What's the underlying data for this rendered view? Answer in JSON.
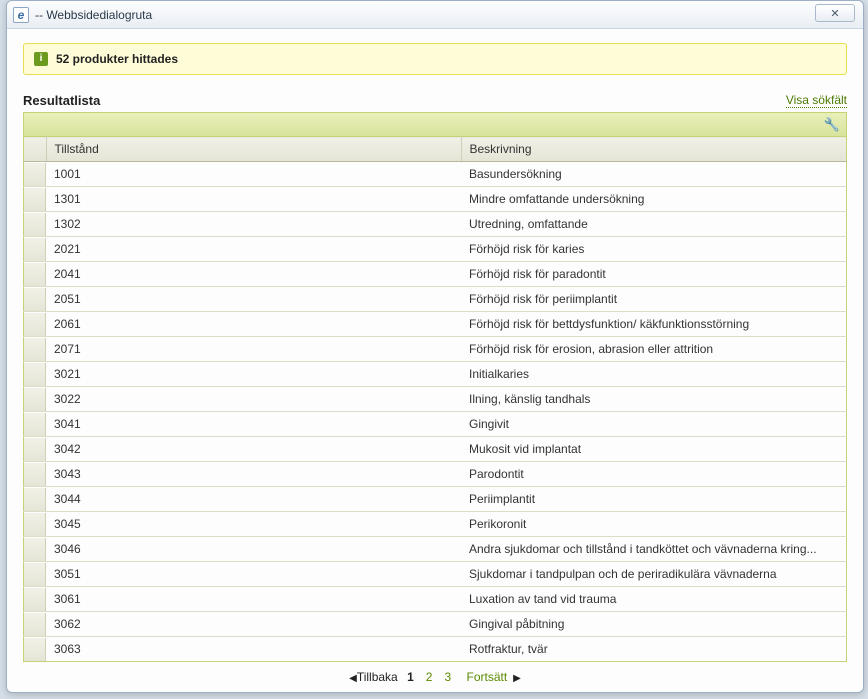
{
  "window": {
    "title": " -- Webbsidedialogruta",
    "close_label": "✕"
  },
  "banner": {
    "message": "52 produkter hittades"
  },
  "list": {
    "title": "Resultatlista",
    "show_search_label": "Visa sökfält"
  },
  "columns": {
    "code": "Tillstånd",
    "desc": "Beskrivning"
  },
  "rows": [
    {
      "code": "1001",
      "desc": "Basundersökning"
    },
    {
      "code": "1301",
      "desc": "Mindre omfattande undersökning"
    },
    {
      "code": "1302",
      "desc": "Utredning, omfattande"
    },
    {
      "code": "2021",
      "desc": "Förhöjd risk för karies"
    },
    {
      "code": "2041",
      "desc": "Förhöjd risk för paradontit"
    },
    {
      "code": "2051",
      "desc": "Förhöjd risk för periimplantit"
    },
    {
      "code": "2061",
      "desc": "Förhöjd risk för bettdysfunktion/ käkfunktionsstörning"
    },
    {
      "code": "2071",
      "desc": "Förhöjd risk för erosion, abrasion eller attrition"
    },
    {
      "code": "3021",
      "desc": "Initialkaries"
    },
    {
      "code": "3022",
      "desc": "Ilning, känslig tandhals"
    },
    {
      "code": "3041",
      "desc": "Gingivit"
    },
    {
      "code": "3042",
      "desc": "Mukosit vid implantat"
    },
    {
      "code": "3043",
      "desc": "Parodontit"
    },
    {
      "code": "3044",
      "desc": "Periimplantit"
    },
    {
      "code": "3045",
      "desc": "Perikoronit"
    },
    {
      "code": "3046",
      "desc": "Andra sjukdomar och tillstånd i tandköttet och vävnaderna kring..."
    },
    {
      "code": "3051",
      "desc": "Sjukdomar i tandpulpan och de periradikulära vävnaderna"
    },
    {
      "code": "3061",
      "desc": "Luxation av tand vid trauma"
    },
    {
      "code": "3062",
      "desc": "Gingival påbitning"
    },
    {
      "code": "3063",
      "desc": "Rotfraktur, tvär"
    }
  ],
  "pager": {
    "back_label": "Tillbaka",
    "forward_label": "Fortsätt",
    "pages": [
      "1",
      "2",
      "3"
    ],
    "current": "1"
  }
}
